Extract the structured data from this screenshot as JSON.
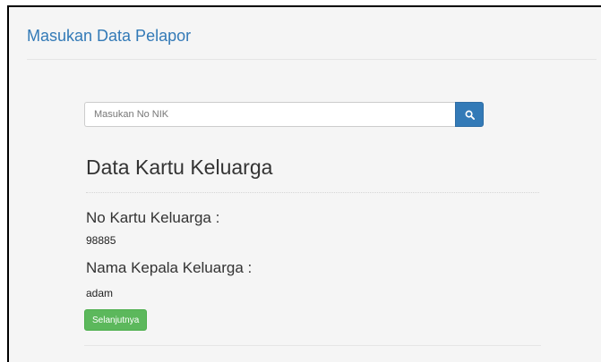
{
  "panel": {
    "title": "Masukan Data Pelapor"
  },
  "search": {
    "placeholder": "Masukan No NIK",
    "value": "",
    "button_icon": "search-icon",
    "button_color": "#337ab7"
  },
  "family_card": {
    "heading": "Data Kartu Keluarga",
    "fields": [
      {
        "label": "No Kartu Keluarga :",
        "value": "98885"
      },
      {
        "label": "Nama Kepala Keluarga :",
        "value": "adam"
      }
    ]
  },
  "actions": {
    "next_label": "Selanjutnya",
    "next_color": "#5cb85c"
  },
  "colors": {
    "title": "#337ab7",
    "background": "#f5f5f5"
  }
}
